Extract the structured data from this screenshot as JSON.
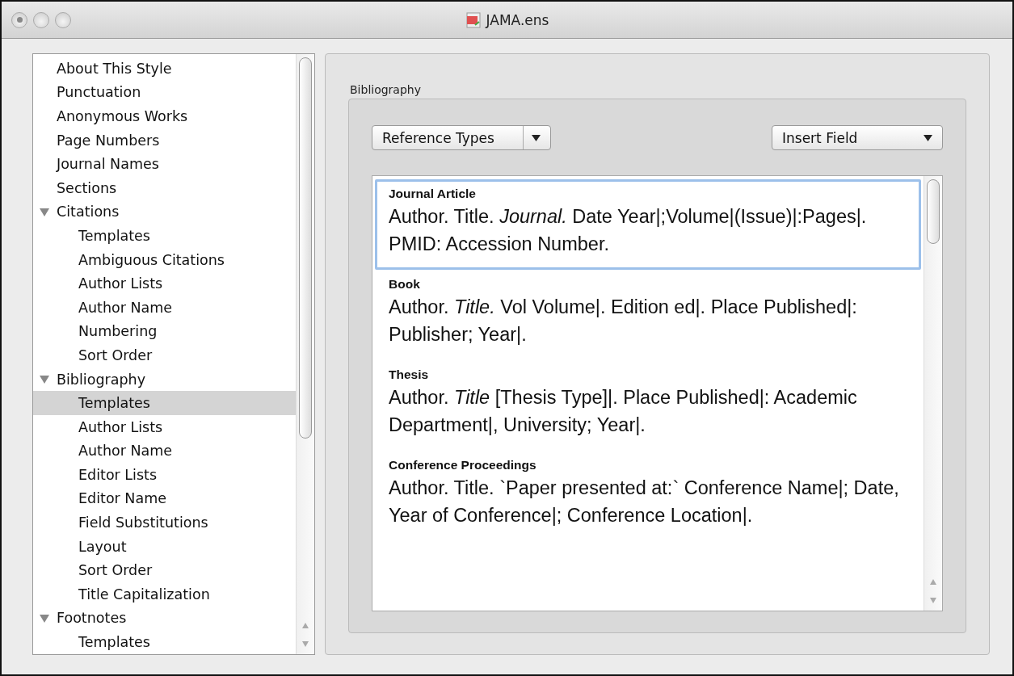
{
  "window": {
    "title": "JAMA.ens"
  },
  "sidebar": {
    "items": [
      {
        "label": "About This Style",
        "selected": false
      },
      {
        "label": "Punctuation",
        "selected": false
      },
      {
        "label": "Anonymous Works",
        "selected": false
      },
      {
        "label": "Page Numbers",
        "selected": false
      },
      {
        "label": "Journal Names",
        "selected": false
      },
      {
        "label": "Sections",
        "selected": false
      },
      {
        "label": "Citations",
        "selected": false,
        "expanded": true,
        "children": [
          {
            "label": "Templates",
            "selected": false
          },
          {
            "label": "Ambiguous Citations",
            "selected": false
          },
          {
            "label": "Author Lists",
            "selected": false
          },
          {
            "label": "Author Name",
            "selected": false
          },
          {
            "label": "Numbering",
            "selected": false
          },
          {
            "label": "Sort Order",
            "selected": false
          }
        ]
      },
      {
        "label": "Bibliography",
        "selected": false,
        "expanded": true,
        "children": [
          {
            "label": "Templates",
            "selected": true
          },
          {
            "label": "Author Lists",
            "selected": false
          },
          {
            "label": "Author Name",
            "selected": false
          },
          {
            "label": "Editor Lists",
            "selected": false
          },
          {
            "label": "Editor Name",
            "selected": false
          },
          {
            "label": "Field Substitutions",
            "selected": false
          },
          {
            "label": "Layout",
            "selected": false
          },
          {
            "label": "Sort Order",
            "selected": false
          },
          {
            "label": "Title Capitalization",
            "selected": false
          }
        ]
      },
      {
        "label": "Footnotes",
        "selected": false,
        "expanded": true,
        "children": [
          {
            "label": "Templates",
            "selected": false
          }
        ]
      }
    ]
  },
  "group": {
    "title": "Bibliography",
    "buttons": [
      {
        "label": "Reference Types"
      },
      {
        "label": "Insert Field"
      }
    ],
    "templates": [
      {
        "type": "Journal Article",
        "text": "Author. Title. *Journal.* Date Year|;Volume|(Issue)|:Pages|. PMID: Accession Number.",
        "selected": true
      },
      {
        "type": "Book",
        "text": "Author. *Title.* Vol Volume|. Edition ed|. Place Published|: Publisher; Year|.",
        "selected": false
      },
      {
        "type": "Thesis",
        "text": "Author. *Title* [Thesis Type]|. Place Published|: Academic Department|, University; Year|.",
        "selected": false
      },
      {
        "type": "Conference Proceedings",
        "text": "Author. Title. `Paper presented at:` Conference Name|; Date, Year of Conference|; Conference Location|.",
        "selected": false
      }
    ]
  }
}
